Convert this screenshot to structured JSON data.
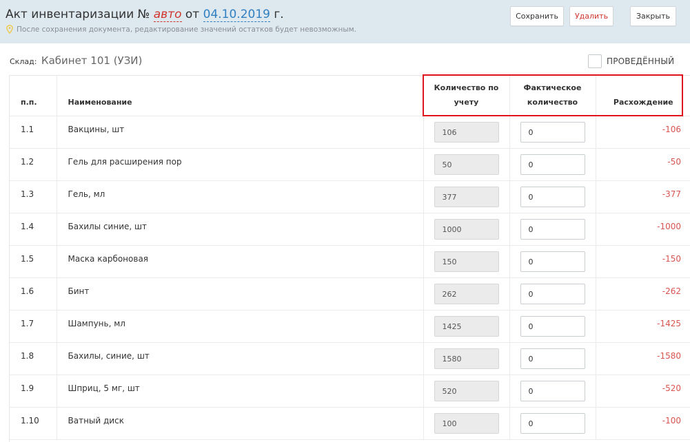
{
  "header": {
    "title_prefix": "Акт инвентаризации №",
    "title_number": "авто",
    "title_from": "от",
    "title_date": "04.10.2019",
    "title_suffix": "г.",
    "hint": "После сохранения документа, редактирование значений остатков будет невозможным.",
    "hint_icon": "pin-icon",
    "buttons": {
      "save": "Сохранить",
      "delete": "Удалить",
      "close": "Закрыть"
    }
  },
  "warehouse": {
    "label": "Склад:",
    "value": "Кабинет 101 (УЗИ)"
  },
  "posted": {
    "label": "ПРОВЕДЁННЫЙ",
    "checked": false
  },
  "table": {
    "columns": {
      "num": "п.п.",
      "name": "Наименование",
      "accounted_line1": "Количество по",
      "accounted_line2": "учету",
      "actual_line1": "Фактическое",
      "actual_line2": "количество",
      "diff": "Расхождение"
    },
    "rows": [
      {
        "num": "1.1",
        "name": "Вакцины, шт",
        "accounted": "106",
        "actual": "0",
        "diff": "-106"
      },
      {
        "num": "1.2",
        "name": "Гель для расширения пор",
        "accounted": "50",
        "actual": "0",
        "diff": "-50"
      },
      {
        "num": "1.3",
        "name": "Гель, мл",
        "accounted": "377",
        "actual": "0",
        "diff": "-377"
      },
      {
        "num": "1.4",
        "name": "Бахилы синие, шт",
        "accounted": "1000",
        "actual": "0",
        "diff": "-1000"
      },
      {
        "num": "1.5",
        "name": "Маска карбоновая",
        "accounted": "150",
        "actual": "0",
        "diff": "-150"
      },
      {
        "num": "1.6",
        "name": "Бинт",
        "accounted": "262",
        "actual": "0",
        "diff": "-262"
      },
      {
        "num": "1.7",
        "name": "Шампунь, мл",
        "accounted": "1425",
        "actual": "0",
        "diff": "-1425"
      },
      {
        "num": "1.8",
        "name": "Бахилы, синие, шт",
        "accounted": "1580",
        "actual": "0",
        "diff": "-1580"
      },
      {
        "num": "1.9",
        "name": "Шприц, 5 мг, шт",
        "accounted": "520",
        "actual": "0",
        "diff": "-520"
      },
      {
        "num": "1.10",
        "name": "Ватный диск",
        "accounted": "100",
        "actual": "0",
        "diff": "-100"
      }
    ]
  },
  "colors": {
    "header_bg": "#dde8ef",
    "accent_blue": "#2f7fc1",
    "danger_red": "#d9534f",
    "highlight_red": "#e0141f"
  }
}
